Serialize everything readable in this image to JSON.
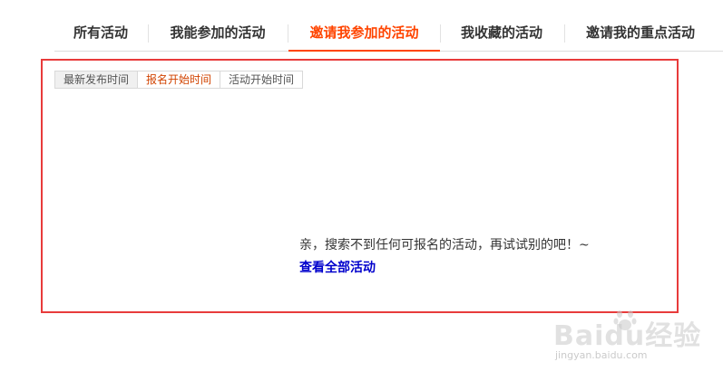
{
  "tabs": [
    {
      "label": "所有活动",
      "active": false
    },
    {
      "label": "我能参加的活动",
      "active": false
    },
    {
      "label": "邀请我参加的活动",
      "active": true
    },
    {
      "label": "我收藏的活动",
      "active": false
    },
    {
      "label": "邀请我的重点活动",
      "active": false
    }
  ],
  "sort": {
    "items": [
      {
        "label": "最新发布时间"
      },
      {
        "label": "报名开始时间"
      },
      {
        "label": "活动开始时间"
      }
    ]
  },
  "empty_state": {
    "message": "亲，搜索不到任何可报名的活动，再试试别的吧！~",
    "link_label": "查看全部活动"
  },
  "watermark": {
    "brand_text": "Baidu经验",
    "url": "jingyan.baidu.com"
  },
  "colors": {
    "accent": "#ff4400",
    "highlight_border": "#e83b3b",
    "link": "#0000cc"
  }
}
